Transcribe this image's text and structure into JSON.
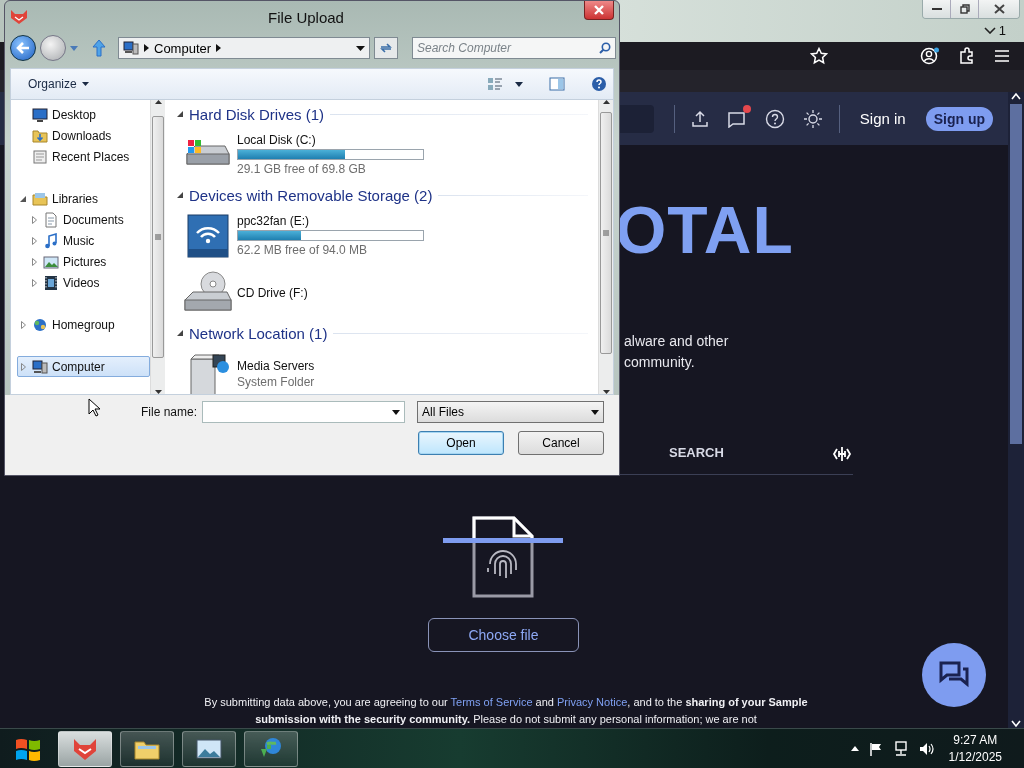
{
  "browser": {
    "tab_count": "1",
    "header": {
      "sign_in": "Sign in",
      "sign_up": "Sign up",
      "notification": true
    },
    "hero": {
      "logo_fragment": "OTAL",
      "tagline": [
        "alware and other",
        "community."
      ],
      "tabs": [
        {
          "label": "SEARCH",
          "selected": false
        }
      ],
      "choose_file": "Choose file",
      "disclaimer": [
        {
          "kind": "text",
          "text": "By submitting data above, you are agreeing to our "
        },
        {
          "kind": "link",
          "text": "Terms of Service"
        },
        {
          "kind": "text",
          "text": " and "
        },
        {
          "kind": "link",
          "text": "Privacy Notice"
        },
        {
          "kind": "text",
          "text": ", and to the **sharing of your Sample submission with the security community.** Please do not submit any personal information; we are not"
        }
      ]
    }
  },
  "dialog": {
    "title": "File Upload",
    "address": [
      "Computer"
    ],
    "search_placeholder": "Search Computer",
    "organize": "Organize",
    "nav": [
      {
        "items": [
          {
            "kind": "desktop",
            "label": "Desktop",
            "selected": false
          },
          {
            "kind": "downloads",
            "label": "Downloads",
            "selected": false
          },
          {
            "kind": "places",
            "label": "Recent Places",
            "selected": false
          }
        ]
      },
      {
        "items": [
          {
            "kind": "library",
            "label": "Libraries",
            "selected": false,
            "expanded": true,
            "children": [
              {
                "kind": "documents",
                "label": "Documents",
                "selected": false,
                "expanded": false
              },
              {
                "kind": "music",
                "label": "Music",
                "selected": false,
                "expanded": false
              },
              {
                "kind": "pictures",
                "label": "Pictures",
                "selected": false,
                "expanded": false
              },
              {
                "kind": "videos",
                "label": "Videos",
                "selected": false,
                "expanded": false
              }
            ]
          }
        ]
      },
      {
        "items": [
          {
            "kind": "homegroup",
            "label": "Homegroup",
            "selected": false,
            "expanded": false
          }
        ]
      },
      {
        "items": [
          {
            "kind": "computer",
            "label": "Computer",
            "selected": true,
            "expanded": false
          }
        ]
      }
    ],
    "groups": [
      {
        "title": "Hard Disk Drives (1)",
        "expanded": true,
        "items": [
          {
            "kind": "hdd",
            "name": "Local Disk (C:)",
            "level": 0.58,
            "free": "29.1 GB free of 69.8 GB"
          }
        ]
      },
      {
        "title": "Devices with Removable Storage (2)",
        "expanded": true,
        "items": [
          {
            "kind": "wireless",
            "name": "ppc32fan (E:)",
            "level": 0.34,
            "free": "62.2 MB free of 94.0 MB"
          },
          {
            "kind": "cd",
            "name": "CD Drive (F:)"
          }
        ]
      },
      {
        "title": "Network Location (1)",
        "expanded": true,
        "items": [
          {
            "kind": "media",
            "name": "Media Servers",
            "detail": "System Folder"
          }
        ]
      }
    ],
    "file_name_label": "File name:",
    "filter": "All Files",
    "buttons": [
      {
        "label": "Open",
        "default": true
      },
      {
        "label": "Cancel",
        "default": false
      }
    ]
  },
  "taskbar": {
    "apps": [
      {
        "kind": "browser",
        "active": true
      },
      {
        "kind": "explorer",
        "active": false
      },
      {
        "kind": "photos",
        "active": false
      },
      {
        "kind": "download",
        "active": false
      }
    ],
    "clock": {
      "time": "9:27 AM",
      "date": "1/12/2025"
    }
  }
}
